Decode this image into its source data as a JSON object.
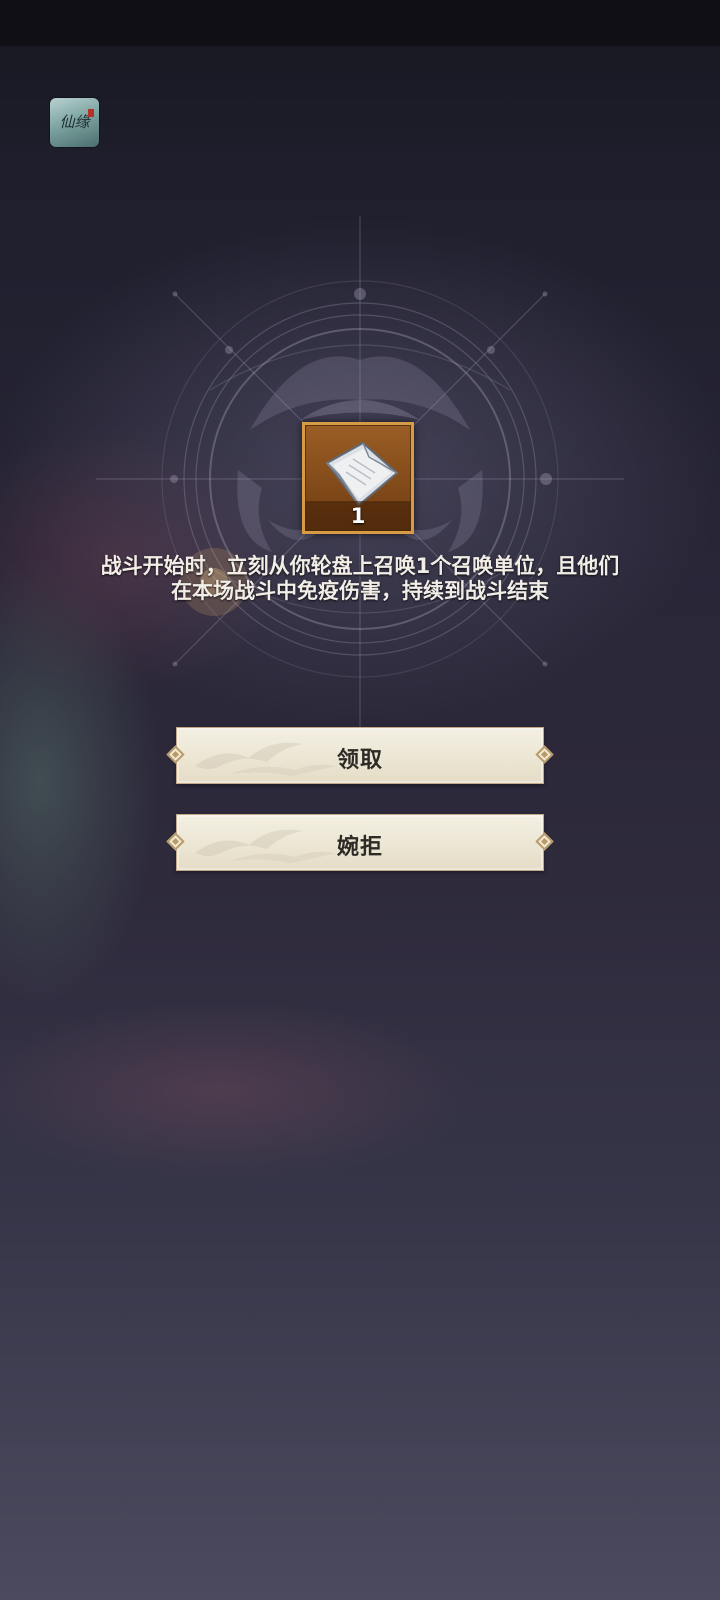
{
  "app": {
    "icon_name": "game-app-icon",
    "icon_text": "仙缘"
  },
  "reward": {
    "icon_name": "scroll-icon",
    "count": "1",
    "frame_color": "#d79a45"
  },
  "description": {
    "line1": "战斗开始时，立刻从你轮盘上召唤1个召唤单位，且他们",
    "line2": "在本场战斗中免疫伤害，持续到战斗结束"
  },
  "actions": {
    "claim_label": "领取",
    "decline_label": "婉拒"
  },
  "colors": {
    "background_top": "#17171f",
    "background_bottom": "#4b4a5e",
    "button_face": "#f3efe2",
    "button_text": "#2e2a26",
    "description_text": "#f2ede6"
  }
}
